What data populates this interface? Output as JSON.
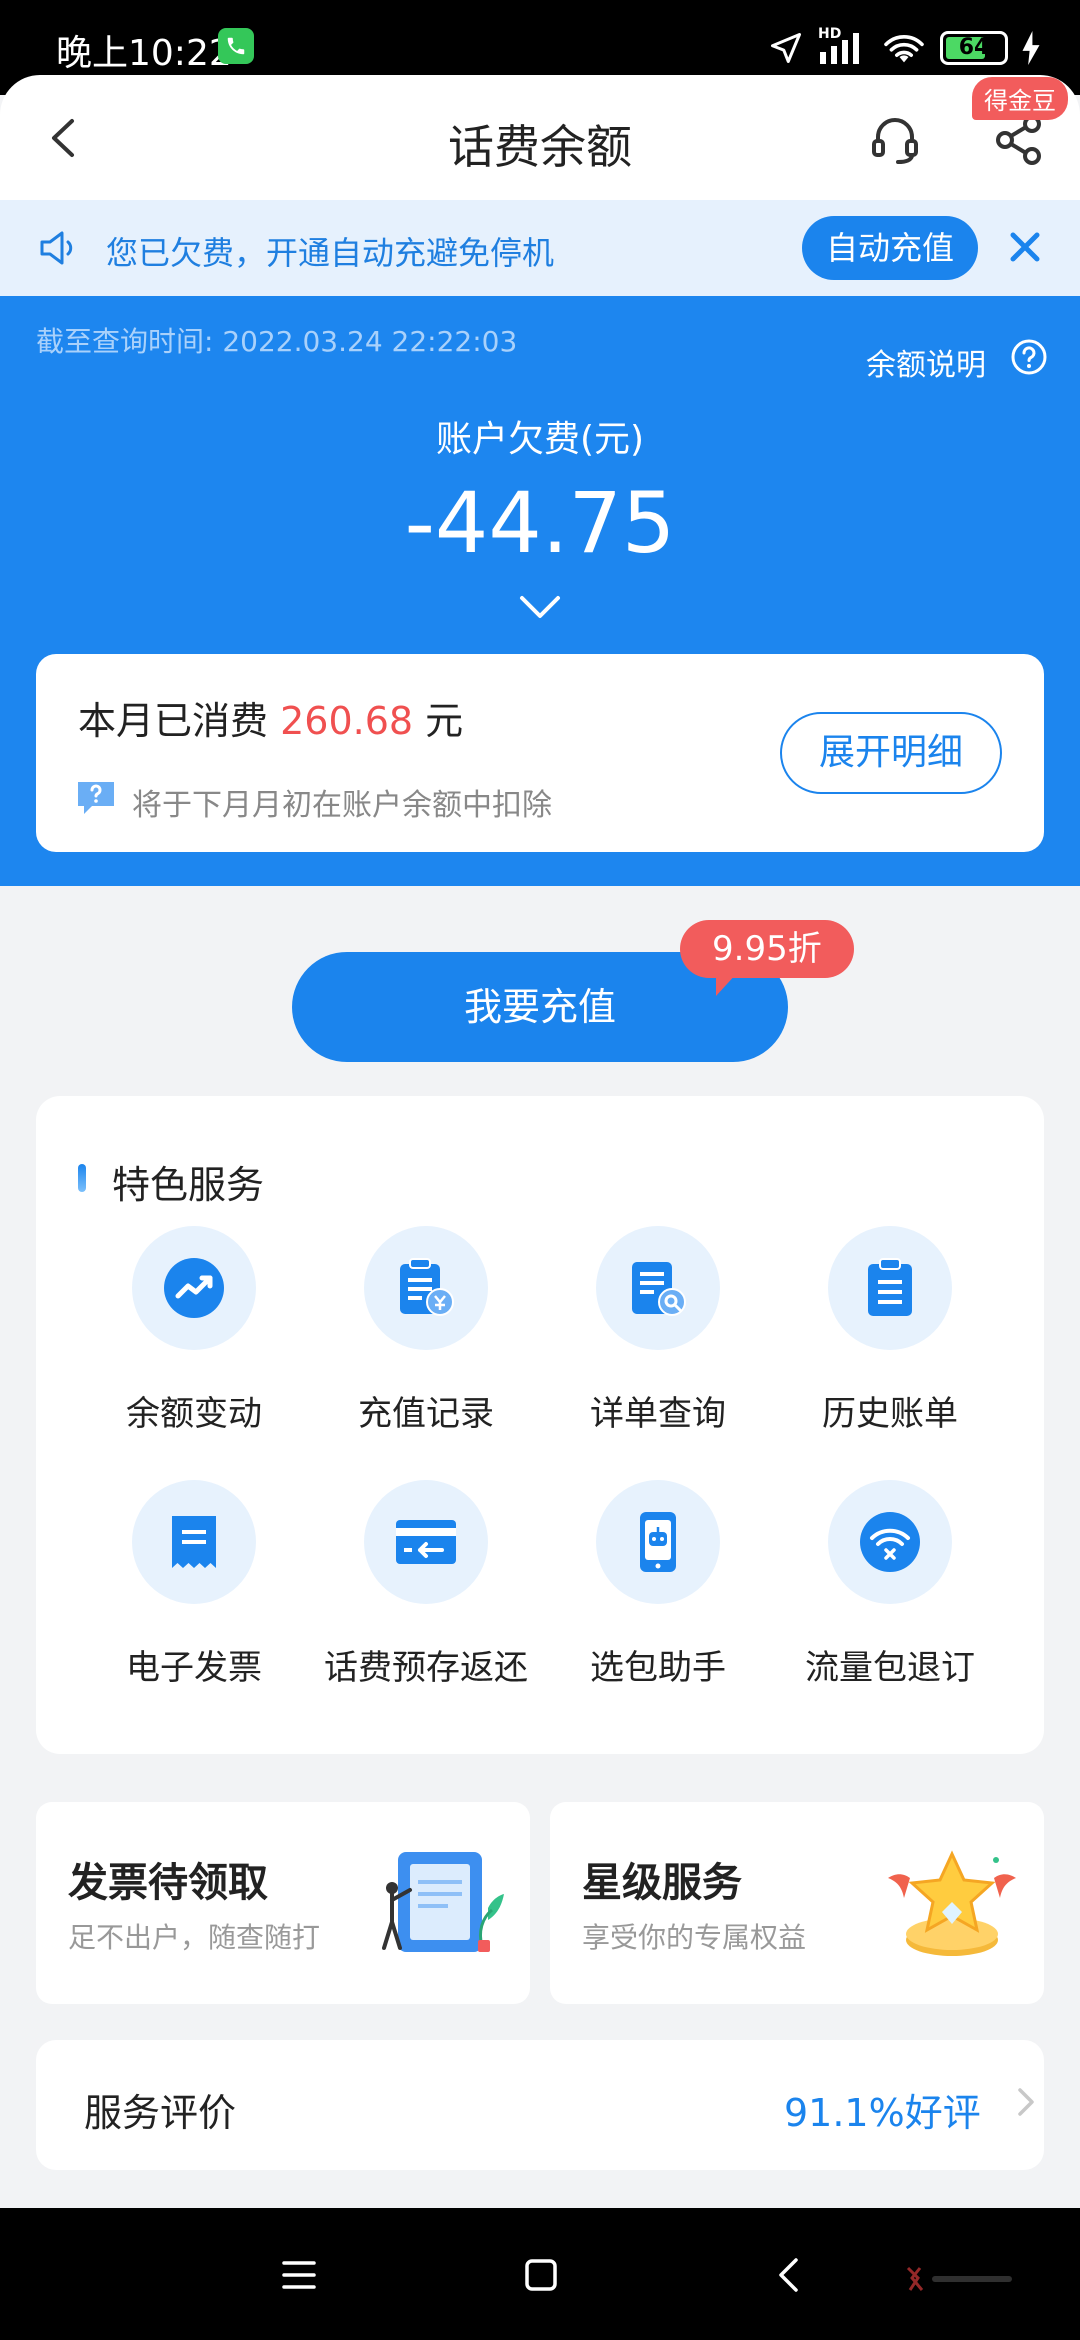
{
  "status_bar": {
    "time": "晚上10:22",
    "battery": "64",
    "signal_label": "HD"
  },
  "header": {
    "title": "话费余额",
    "badge": "得金豆"
  },
  "notice": {
    "text": "您已欠费，开通自动充避免停机",
    "button": "自动充值"
  },
  "balance": {
    "query_time": "截至查询时间: 2022.03.24 22:22:03",
    "note_link": "余额说明",
    "label": "账户欠费(元)",
    "amount": "-44.75"
  },
  "consumption": {
    "prefix": "本月已消费",
    "amount": "260.68",
    "unit": "元",
    "hint": "将于下月月初在账户余额中扣除",
    "detail_button": "展开明细"
  },
  "recharge": {
    "button": "我要充值",
    "discount": "9.95折"
  },
  "services": {
    "title": "特色服务",
    "items": [
      {
        "label": "余额变动",
        "icon": "trend-chart-icon"
      },
      {
        "label": "充值记录",
        "icon": "recharge-record-icon"
      },
      {
        "label": "详单查询",
        "icon": "detail-search-icon"
      },
      {
        "label": "历史账单",
        "icon": "clipboard-icon"
      },
      {
        "label": "电子发票",
        "icon": "invoice-icon"
      },
      {
        "label": "话费预存返还",
        "icon": "card-return-icon"
      },
      {
        "label": "选包助手",
        "icon": "phone-robot-icon"
      },
      {
        "label": "流量包退订",
        "icon": "wifi-cancel-icon"
      }
    ]
  },
  "promos": [
    {
      "title": "发票待领取",
      "subtitle": "足不出户，随查随打"
    },
    {
      "title": "星级服务",
      "subtitle": "享受你的专属权益"
    }
  ],
  "rating": {
    "label": "服务评价",
    "value": "91.1%好评"
  },
  "colors": {
    "primary": "#1d86ef",
    "accent_red": "#f05050",
    "notice_bg": "#e6f1fd",
    "page_bg": "#f2f3f5"
  }
}
